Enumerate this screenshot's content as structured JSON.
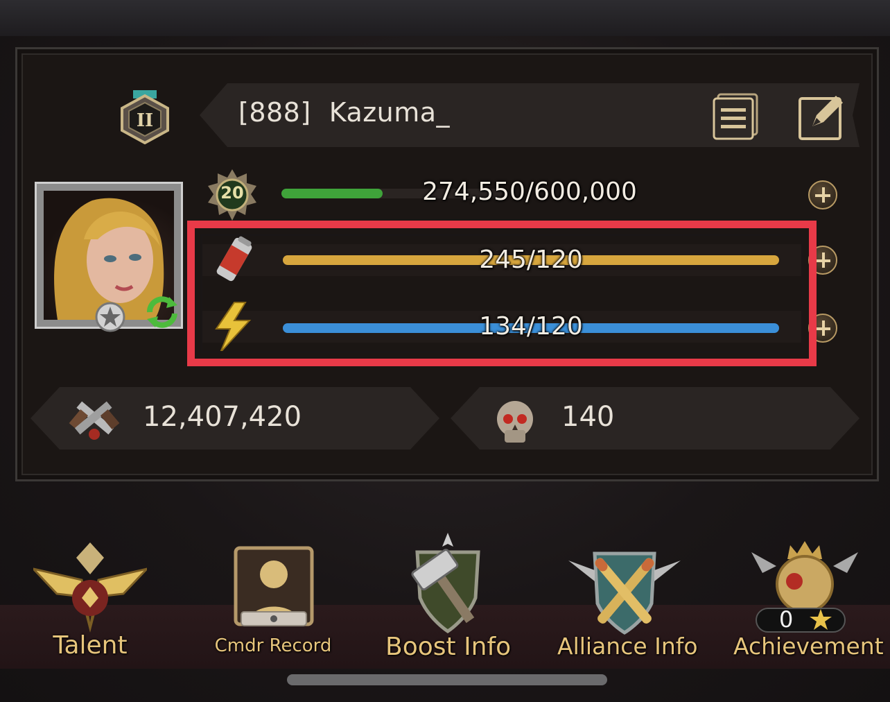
{
  "player": {
    "alliance_tag": "[888]",
    "name": "Kazuma_",
    "rank_roman": "II",
    "level": "20"
  },
  "bars": {
    "exp_text": "274,550/600,000",
    "exp_fraction": 0.46,
    "stamina_text": "245/120",
    "stamina_fraction": 1.0,
    "energy_text": "134/120",
    "energy_fraction": 1.0
  },
  "stats": {
    "power": "12,407,420",
    "kills": "140"
  },
  "nav": {
    "talent": "Talent",
    "cmdr_record": "Cmdr Record",
    "boost_info": "Boost Info",
    "alliance_info": "Alliance Info",
    "achievement": "Achievement",
    "achievement_count": "0"
  },
  "colors": {
    "exp_bar": "#3fa33a",
    "stamina_bar": "#d7a63e",
    "energy_bar": "#3b8fd8",
    "highlight": "#e83a48",
    "gold_label": "#e7c57c"
  },
  "icons": {
    "rank": "rank-badge-icon",
    "list": "list-icon",
    "edit": "edit-icon",
    "level": "level-badge-icon",
    "stamina": "stamina-can-icon",
    "energy": "lightning-icon",
    "power": "crossed-pistols-icon",
    "kills": "skull-icon"
  }
}
